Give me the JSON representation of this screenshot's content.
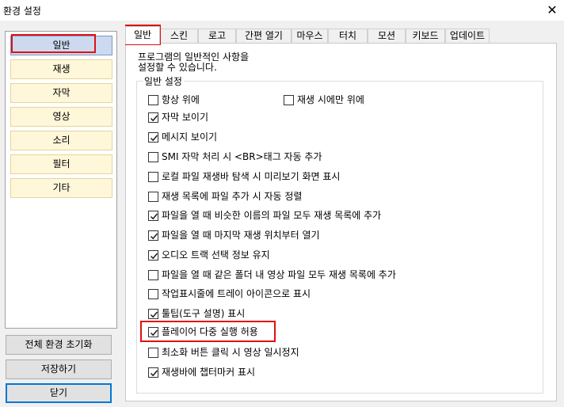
{
  "window": {
    "title": "환경 설정"
  },
  "categories": [
    "일반",
    "재생",
    "자막",
    "영상",
    "소리",
    "필터",
    "기타"
  ],
  "buttons": {
    "reset": "전체 환경 초기화",
    "save": "저장하기",
    "close": "닫기"
  },
  "tabs": [
    "일반",
    "스킨",
    "로고",
    "간편 열기",
    "마우스",
    "터치",
    "모션",
    "키보드",
    "업데이트"
  ],
  "page": {
    "description_line1": "프로그램의 일반적인 사항을",
    "description_line2": "설정할 수 있습니다.",
    "group_label": "일반 설정"
  },
  "options": [
    {
      "label": "항상 위에",
      "checked": false
    },
    {
      "label": "재생 시에만 위에",
      "checked": false
    },
    {
      "label": "자막 보이기",
      "checked": true
    },
    {
      "label": "메시지 보이기",
      "checked": true
    },
    {
      "label": "SMI 자막 처리 시 <BR>태그 자동 추가",
      "checked": false
    },
    {
      "label": "로컬 파일 재생바 탐색 시 미리보기 화면 표시",
      "checked": false
    },
    {
      "label": "재생 목록에 파일 추가 시 자동 정렬",
      "checked": false
    },
    {
      "label": "파일을 열 때 비슷한 이름의 파일 모두 재생 목록에 추가",
      "checked": true
    },
    {
      "label": "파일을 열 때 마지막 재생 위치부터 열기",
      "checked": true
    },
    {
      "label": "오디오 트랙 선택 정보 유지",
      "checked": true
    },
    {
      "label": "파일을 열 때 같은 폴더 내 영상 파일 모두 재생 목록에 추가",
      "checked": false
    },
    {
      "label": "작업표시줄에 트레이 아이콘으로 표시",
      "checked": false
    },
    {
      "label": "툴팁(도구 설명) 표시",
      "checked": true
    },
    {
      "label": "플레이어 다중 실행 허용",
      "checked": true
    },
    {
      "label": "최소화 버튼 클릭 시 영상 일시정지",
      "checked": false
    },
    {
      "label": "재생바에 챕터마커 표시",
      "checked": true
    }
  ],
  "icons": {
    "close": "close-icon",
    "check": "checkmark-icon"
  },
  "colors": {
    "highlight": "#e01010",
    "selected_category": "#ccd9ee",
    "category_bg": "#fff7d9"
  }
}
